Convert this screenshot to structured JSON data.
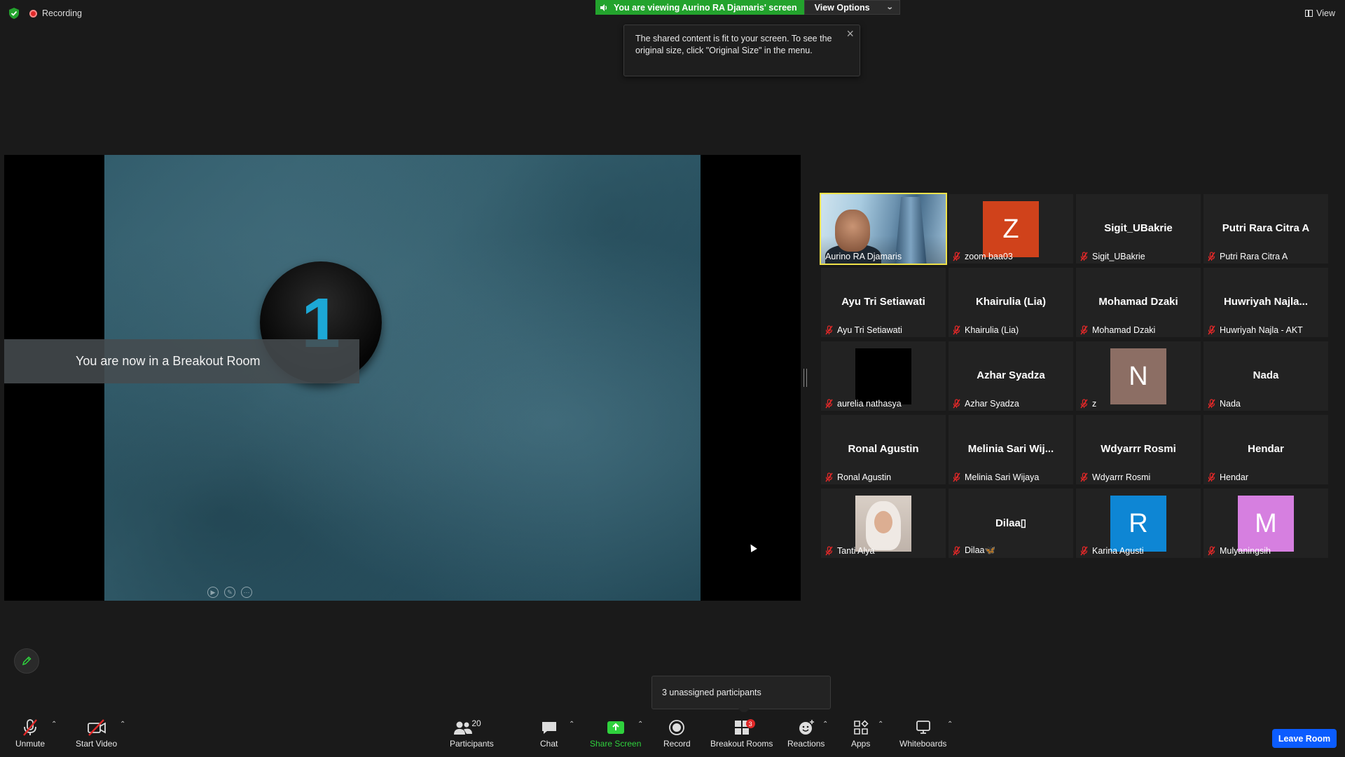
{
  "header": {
    "recording_label": "Recording",
    "viewing_text": "You are viewing Aurino RA Djamaris' screen",
    "view_options_label": "View Options",
    "view_label": "View"
  },
  "tooltip": {
    "text": "The shared content is fit to your screen. To see the original size, click \"Original Size\" in the menu."
  },
  "shared_screen": {
    "badge_number": "1",
    "banner_text": "You are now in a Breakout Room"
  },
  "gallery": {
    "tiles": [
      {
        "display_name": "",
        "label": "Aurino RA Djamaris",
        "type": "video",
        "muted": false,
        "active": true
      },
      {
        "display_name": "",
        "label": "zoom baa03",
        "type": "avatar",
        "avatar_letter": "Z",
        "avatar_color": "#d0421b",
        "muted": true
      },
      {
        "display_name": "Sigit_UBakrie",
        "label": "Sigit_UBakrie",
        "type": "name",
        "muted": true
      },
      {
        "display_name": "Putri Rara Citra A",
        "label": "Putri Rara Citra A",
        "type": "name",
        "muted": true
      },
      {
        "display_name": "Ayu Tri Setiawati",
        "label": "Ayu Tri Setiawati",
        "type": "name",
        "muted": true
      },
      {
        "display_name": "Khairulia (Lia)",
        "label": "Khairulia (Lia)",
        "type": "name",
        "muted": true
      },
      {
        "display_name": "Mohamad Dzaki",
        "label": "Mohamad Dzaki",
        "type": "name",
        "muted": true
      },
      {
        "display_name": "Huwriyah  Najla...",
        "label": "Huwriyah Najla - AKT",
        "type": "name",
        "muted": true
      },
      {
        "display_name": "",
        "label": "aurelia nathasya",
        "type": "black",
        "muted": true
      },
      {
        "display_name": "Azhar Syadza",
        "label": "Azhar Syadza",
        "type": "name",
        "muted": true
      },
      {
        "display_name": "",
        "label": "z",
        "type": "avatar",
        "avatar_letter": "N",
        "avatar_color": "#8c6e64",
        "muted": true
      },
      {
        "display_name": "Nada",
        "label": "Nada",
        "type": "name",
        "muted": true
      },
      {
        "display_name": "Ronal Agustin",
        "label": "Ronal Agustin",
        "type": "name",
        "muted": true
      },
      {
        "display_name": "Melinia  Sari  Wij...",
        "label": "Melinia Sari Wijaya",
        "type": "name",
        "muted": true
      },
      {
        "display_name": "Wdyarrr Rosmi",
        "label": "Wdyarrr Rosmi",
        "type": "name",
        "muted": true
      },
      {
        "display_name": "Hendar",
        "label": "Hendar",
        "type": "name",
        "muted": true
      },
      {
        "display_name": "",
        "label": "Tanti Alya",
        "type": "photo",
        "muted": true
      },
      {
        "display_name": "Dilaa▯",
        "label": "Dilaa🦋",
        "type": "name",
        "muted": true
      },
      {
        "display_name": "",
        "label": "Karina Agusti",
        "type": "avatar",
        "avatar_letter": "R",
        "avatar_color": "#0e86d4",
        "muted": true
      },
      {
        "display_name": "",
        "label": "Mulyaningsih",
        "type": "avatar",
        "avatar_letter": "M",
        "avatar_color": "#d67fe0",
        "muted": true
      }
    ]
  },
  "popup": {
    "unassigned_text": "3 unassigned participants"
  },
  "toolbar": {
    "unmute_label": "Unmute",
    "start_video_label": "Start Video",
    "participants_label": "Participants",
    "participants_count": "20",
    "chat_label": "Chat",
    "share_screen_label": "Share Screen",
    "record_label": "Record",
    "breakout_rooms_label": "Breakout Rooms",
    "breakout_badge": "3",
    "reactions_label": "Reactions",
    "apps_label": "Apps",
    "whiteboards_label": "Whiteboards",
    "leave_room_label": "Leave Room"
  },
  "colors": {
    "share_green": "#23a32d",
    "leave_blue": "#0b5cff",
    "active_speaker": "#f0e24a",
    "mute_red": "#e02828"
  }
}
